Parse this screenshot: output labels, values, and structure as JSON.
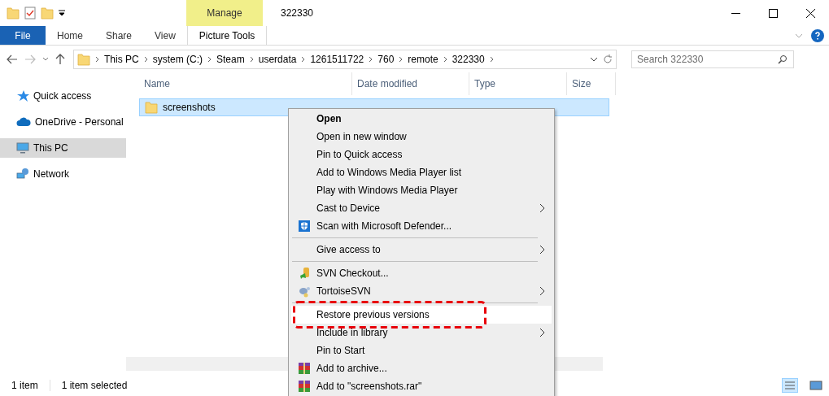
{
  "window": {
    "title": "322330"
  },
  "quick_access_toolbar": {
    "items": [
      {
        "kind": "folder"
      },
      {
        "kind": "properties"
      },
      {
        "kind": "new-folder"
      },
      {
        "kind": "customize"
      }
    ]
  },
  "ribbon": {
    "context_tab_group": "Manage",
    "tabs": [
      {
        "label": "File",
        "selected": true,
        "kind": "file"
      },
      {
        "label": "Home",
        "selected": false,
        "kind": "plain"
      },
      {
        "label": "Share",
        "selected": false,
        "kind": "plain"
      },
      {
        "label": "View",
        "selected": false,
        "kind": "plain"
      },
      {
        "label": "Picture Tools",
        "selected": false,
        "kind": "context"
      }
    ]
  },
  "address_bar": {
    "path": [
      "This PC",
      "system (C:)",
      "Steam",
      "userdata",
      "1261511722",
      "760",
      "remote",
      "322330"
    ]
  },
  "search": {
    "placeholder": "Search 322330"
  },
  "sidebar": {
    "items": [
      {
        "label": "Quick access",
        "kind": "star",
        "selected": false
      },
      {
        "label": "OneDrive - Personal",
        "kind": "cloud",
        "selected": false
      },
      {
        "label": "This PC",
        "kind": "monitor",
        "selected": true
      },
      {
        "label": "Network",
        "kind": "network",
        "selected": false
      }
    ]
  },
  "table": {
    "columns": [
      "Name",
      "Date modified",
      "Type",
      "Size"
    ],
    "rows": [
      {
        "name": "screenshots",
        "selected": true
      }
    ]
  },
  "context_menu": {
    "items": [
      {
        "kind": "item",
        "label": "Open",
        "default": true,
        "submenu": false,
        "highlighted": false
      },
      {
        "kind": "item",
        "label": "Open in new window",
        "default": false,
        "submenu": false,
        "highlighted": false
      },
      {
        "kind": "item",
        "label": "Pin to Quick access",
        "default": false,
        "submenu": false,
        "highlighted": false
      },
      {
        "kind": "item",
        "label": "Add to Windows Media Player list",
        "default": false,
        "submenu": false,
        "highlighted": false
      },
      {
        "kind": "item",
        "label": "Play with Windows Media Player",
        "default": false,
        "submenu": false,
        "highlighted": false
      },
      {
        "kind": "item",
        "label": "Cast to Device",
        "default": false,
        "submenu": true,
        "highlighted": false
      },
      {
        "kind": "shield",
        "label": "Scan with Microsoft Defender...",
        "default": false,
        "submenu": false,
        "highlighted": false
      },
      {
        "kind": "separator"
      },
      {
        "kind": "item",
        "label": "Give access to",
        "default": false,
        "submenu": true,
        "highlighted": false
      },
      {
        "kind": "separator"
      },
      {
        "kind": "checkout",
        "label": "SVN Checkout...",
        "default": false,
        "submenu": false,
        "highlighted": false
      },
      {
        "kind": "tortoise",
        "label": "TortoiseSVN",
        "default": false,
        "submenu": true,
        "highlighted": false
      },
      {
        "kind": "separator"
      },
      {
        "kind": "item",
        "label": "Restore previous versions",
        "default": false,
        "submenu": false,
        "highlighted": true,
        "annotated": true
      },
      {
        "kind": "item",
        "label": "Include in library",
        "default": false,
        "submenu": true,
        "highlighted": false
      },
      {
        "kind": "item",
        "label": "Pin to Start",
        "default": false,
        "submenu": false,
        "highlighted": false
      },
      {
        "kind": "archive",
        "label": "Add to archive...",
        "default": false,
        "submenu": false,
        "highlighted": false
      },
      {
        "kind": "archive",
        "label": "Add to \"screenshots.rar\"",
        "default": false,
        "submenu": false,
        "highlighted": false
      }
    ]
  },
  "status_bar": {
    "item_count": "1 item",
    "selection": "1 item selected"
  }
}
